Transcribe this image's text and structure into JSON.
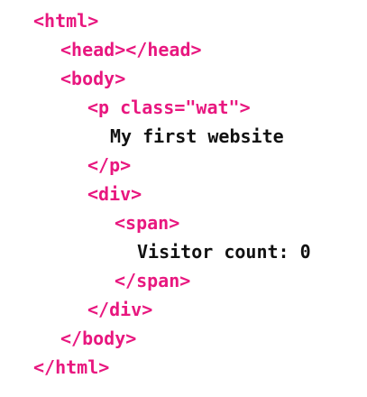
{
  "code": {
    "lines": [
      {
        "text": "<html>",
        "kind": "tag"
      },
      {
        "text": "<head></head>",
        "kind": "tag"
      },
      {
        "text": "<body>",
        "kind": "tag"
      },
      {
        "text": "<p class=\"wat\">",
        "kind": "tag"
      },
      {
        "text": "My first website",
        "kind": "text"
      },
      {
        "text": "</p>",
        "kind": "tag"
      },
      {
        "text": "<div>",
        "kind": "tag"
      },
      {
        "text": "<span>",
        "kind": "tag"
      },
      {
        "text": "Visitor count: 0",
        "kind": "text"
      },
      {
        "text": "</span>",
        "kind": "tag"
      },
      {
        "text": "</div>",
        "kind": "tag"
      },
      {
        "text": "</body>",
        "kind": "tag"
      },
      {
        "text": "</html>",
        "kind": "tag"
      }
    ]
  },
  "colors": {
    "tag": "#e8177f",
    "text": "#111111",
    "background": "#ffffff"
  }
}
